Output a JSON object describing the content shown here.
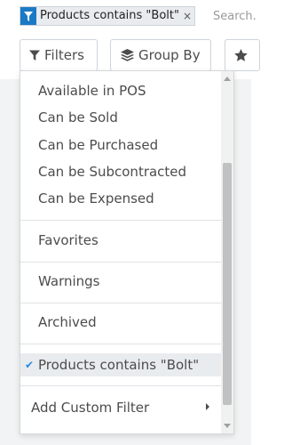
{
  "search": {
    "facet_text": "Products contains \"Bolt\"",
    "facet_remove": "×",
    "placeholder": "Search..."
  },
  "buttons": {
    "filters_label": "Filters",
    "group_by_label": "Group By"
  },
  "colors": {
    "accent": "#1a7ac6",
    "check": "#2c8ae0",
    "text": "#4c4c4c"
  },
  "dropdown": {
    "group1": [
      "Available in POS",
      "Can be Sold",
      "Can be Purchased",
      "Can be Subcontracted",
      "Can be Expensed"
    ],
    "favorites": "Favorites",
    "warnings": "Warnings",
    "archived": "Archived",
    "selected_filter": "Products contains \"Bolt\"",
    "check_mark": "✔",
    "add_custom": "Add Custom Filter"
  }
}
